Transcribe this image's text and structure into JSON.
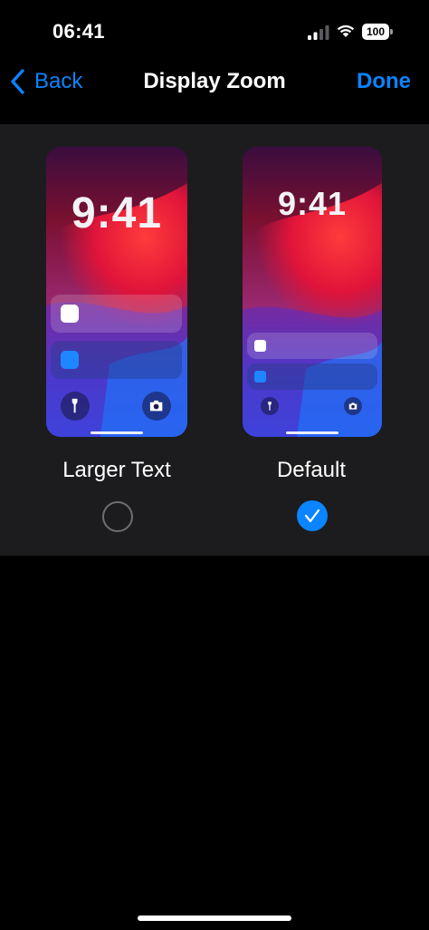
{
  "status_bar": {
    "time": "06:41",
    "battery": "100",
    "icons": [
      "signal-icon",
      "wifi-icon",
      "battery-icon"
    ]
  },
  "nav": {
    "back_label": "Back",
    "title": "Display Zoom",
    "done_label": "Done",
    "accent_color": "#0a84ff"
  },
  "options": [
    {
      "label": "Larger Text",
      "preview_time": "9:41",
      "selected": false
    },
    {
      "label": "Default",
      "preview_time": "9:41",
      "selected": true
    }
  ],
  "colors": {
    "background": "#000000",
    "panel": "#1c1c1e",
    "radio_selected": "#0a84ff",
    "radio_unselected_border": "#6e6e73"
  }
}
